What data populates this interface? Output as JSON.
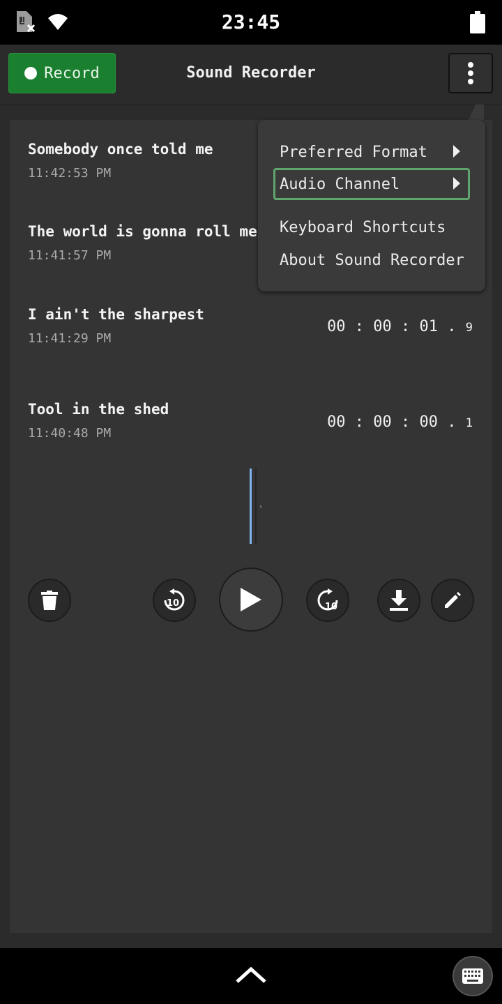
{
  "status_bar": {
    "time": "23:45",
    "icons": [
      "sim-card-off-icon",
      "wifi-icon",
      "battery-icon"
    ]
  },
  "header": {
    "record_label": "Record",
    "title": "Sound Recorder",
    "menu_icon": "more-vert-icon"
  },
  "recordings": [
    {
      "title": "Somebody once told me",
      "time": "11:42:53 PM",
      "duration": "",
      "duration_frac": ""
    },
    {
      "title": "The world is gonna roll me",
      "time": "11:41:57 PM",
      "duration": "",
      "duration_frac": ""
    },
    {
      "title": "I ain't the sharpest",
      "time": "11:41:29 PM",
      "duration": "00 : 00 : 01 .",
      "duration_frac": "9"
    },
    {
      "title": "Tool in the shed",
      "time": "11:40:48 PM",
      "duration": "00 : 00 : 00 .",
      "duration_frac": "1"
    }
  ],
  "controls": [
    "delete-icon",
    "replay-10-icon",
    "play-icon",
    "forward-10-icon",
    "download-icon",
    "edit-icon"
  ],
  "menu": {
    "items": [
      {
        "label": "Preferred Format",
        "has_submenu": true
      },
      {
        "label": "Audio Channel",
        "has_submenu": true,
        "focused": true
      },
      {
        "label": "Keyboard Shortcuts",
        "has_submenu": false
      },
      {
        "label": "About Sound Recorder",
        "has_submenu": false
      }
    ]
  },
  "colors": {
    "record_green": "#1a7f2e",
    "focus_outline": "#5fa56d",
    "waveform_cursor": "#7fb3f0",
    "background": "#2b2b2b",
    "panel": "#343434"
  }
}
